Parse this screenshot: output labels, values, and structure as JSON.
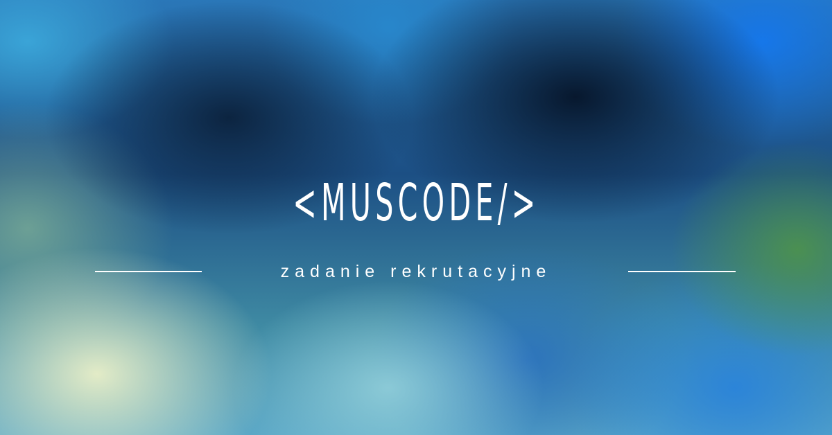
{
  "banner": {
    "title": "<MUSCODE/>",
    "subtitle": "zadanie rekrutacyjne"
  },
  "colors": {
    "text": "#ffffff",
    "background_dark": "#0b2a4a",
    "background_blue": "#1c75d8",
    "background_green": "#5aa04a",
    "background_light": "#eef2c8"
  }
}
